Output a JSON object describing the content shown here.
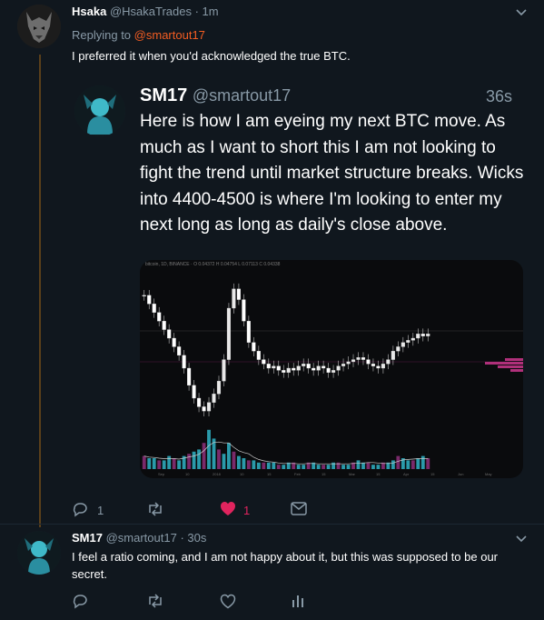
{
  "tweet1": {
    "name": "Hsaka",
    "handle": "@HsakaTrades",
    "time": "· 1m",
    "replying_prefix": "Replying to",
    "replying_to": "@smartout17",
    "text": "I preferred it when you'd acknowledged the true BTC."
  },
  "quote": {
    "name": "SM17",
    "handle": "@smartout17",
    "time": "36s",
    "text": "Here is how I am eyeing my next BTC move. As much as I want to short this I am not looking to fight the trend until market structure breaks. Wicks into 4400-4500 is where I'm looking to enter my next long as long as daily's close above."
  },
  "chart_header": "bitcoin, 1D, BINANCE · O 0.04372 H 0.04754 L 0.07113 C 0.04338",
  "chart_data": {
    "type": "candlestick",
    "series": [
      {
        "name": "price",
        "values": [
          92,
          88,
          84,
          80,
          76,
          72,
          68,
          64,
          58,
          50,
          44,
          40,
          38,
          42,
          46,
          52,
          62,
          86,
          95,
          90,
          80,
          70,
          66,
          62,
          60,
          58,
          59,
          57,
          56,
          58,
          57,
          59,
          60,
          58,
          57,
          59,
          58,
          56,
          57,
          59,
          60,
          61,
          62,
          63,
          62,
          60,
          59,
          58,
          60,
          62,
          66,
          68,
          70,
          71,
          72,
          74,
          73,
          74
        ]
      },
      {
        "name": "volume",
        "values": [
          6,
          5,
          5,
          4,
          4,
          6,
          5,
          4,
          6,
          7,
          8,
          9,
          12,
          18,
          14,
          9,
          7,
          12,
          8,
          6,
          5,
          4,
          4,
          3,
          3,
          3,
          3,
          2,
          2,
          3,
          3,
          2,
          2,
          3,
          3,
          2,
          2,
          2,
          3,
          3,
          2,
          2,
          3,
          4,
          3,
          3,
          2,
          2,
          3,
          3,
          4,
          6,
          5,
          4,
          4,
          5,
          6,
          5
        ]
      }
    ],
    "x_tick_labels": [
      "Sep",
      "10",
      "2018",
      "10",
      "15",
      "Feb",
      "15",
      "Mar",
      "15",
      "Apr",
      "15",
      "Jun",
      "May"
    ]
  },
  "tweet1_actions": {
    "reply_count": "1",
    "retweet_count": "",
    "like_count": "1"
  },
  "tweet2": {
    "name": "SM17",
    "handle": "@smartout17",
    "time": "· 30s",
    "text": "I feel a ratio coming, and I am not happy about it, but this was supposed to be our secret."
  },
  "icons": {
    "reply": "reply-icon",
    "retweet": "retweet-icon",
    "like": "heart-icon",
    "dm": "envelope-icon",
    "analytics": "analytics-icon",
    "caret": "chevron-down-icon"
  },
  "colors": {
    "background": "#10171e",
    "accent_link": "#f45d22",
    "like_active": "#e0245e",
    "muted": "#8899a6",
    "thread_line": "#5a3f1b"
  }
}
